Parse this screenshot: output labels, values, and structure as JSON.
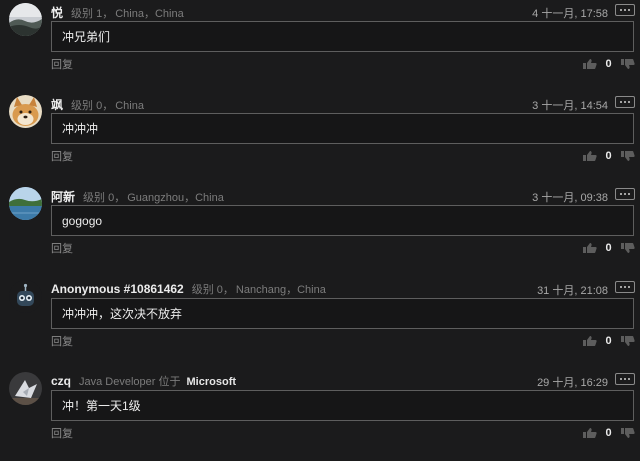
{
  "comments": [
    {
      "name": "悦",
      "level": "级别 1，",
      "location": "China，China",
      "time": "4 十一月, 17:58",
      "text": "冲兄弟们",
      "reply": "回复",
      "likes": "0",
      "avatar": "landscape-photo"
    },
    {
      "name": "飒",
      "level": "级别 0，",
      "location": "China",
      "time": "3 十一月, 14:54",
      "text": "冲冲冲",
      "reply": "回复",
      "likes": "0",
      "avatar": "shiba-dog-photo"
    },
    {
      "name": "阿新",
      "level": "级别 0，",
      "location": "Guangzhou，China",
      "time": "3 十一月, 09:38",
      "text": "gogogo",
      "reply": "回复",
      "likes": "0",
      "avatar": "lake-landscape-photo"
    },
    {
      "name": "Anonymous #10861462",
      "level": "级别 0，",
      "location": "Nanchang，China",
      "time": "31 十月, 21:08",
      "text": "冲冲冲，这次决不放弃",
      "reply": "回复",
      "likes": "0",
      "avatar": "robot-avatar"
    },
    {
      "name": "czq",
      "title": "Java Developer 位于",
      "company": "Microsoft",
      "time": "29 十月, 16:29",
      "text": "冲！第一天1级",
      "reply": "回复",
      "likes": "0",
      "avatar": "bird-photo"
    }
  ],
  "colors": {
    "background": "#1b1b1c",
    "border": "#5e5e5e",
    "muted": "#7c7c7c"
  },
  "icons": {
    "vote_up": "thumbs-up-icon",
    "vote_down": "thumbs-down-icon",
    "more": "more-dots-icon"
  }
}
